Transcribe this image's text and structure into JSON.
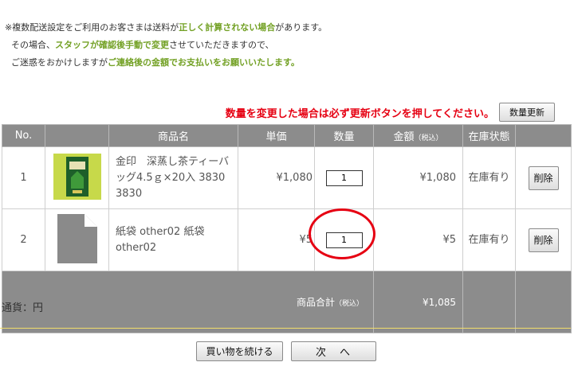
{
  "notice": {
    "line1": [
      {
        "t": "※複数配送設定をご利用のお客さまは送料が",
        "g": false
      },
      {
        "t": "正しく計算されない場合",
        "g": true
      },
      {
        "t": "があります。",
        "g": false
      }
    ],
    "line2": [
      {
        "t": "その場合、",
        "g": false
      },
      {
        "t": "スタッフが確認後手動で変更",
        "g": true
      },
      {
        "t": "させていただきますので、",
        "g": false
      }
    ],
    "line3": [
      {
        "t": "ご迷惑をおかけしますが",
        "g": false
      },
      {
        "t": "ご連絡後の金額でお支払いをお願いいたします。",
        "g": true
      }
    ]
  },
  "update": {
    "message": "数量を変更した場合は必ず更新ボタンを押してください。",
    "button": "数量更新"
  },
  "table": {
    "headers": {
      "no": "No.",
      "name": "商品名",
      "unit_price": "単価",
      "qty": "数量",
      "amount": "金額",
      "amount_tax": "（税込）",
      "stock": "在庫状態"
    },
    "rows": [
      {
        "no": "1",
        "image": "tea-package",
        "name": "金印　深蒸し茶ティーバッグ4.5ｇ×20入 3830 3830",
        "price": "¥1,080",
        "qty": "1",
        "amount": "¥1,080",
        "stock": "在庫有り",
        "delete": "削除"
      },
      {
        "no": "2",
        "image": "no-image-placeholder",
        "name": "紙袋 other02 紙袋 other02",
        "price": "¥5",
        "qty": "1",
        "amount": "¥5",
        "stock": "在庫有り",
        "delete": "削除"
      }
    ],
    "total_label": "商品合計",
    "total_tax": "（税込）",
    "total_value": "¥1,085"
  },
  "currency": "通貨：円",
  "buttons": {
    "continue": "買い物を続ける",
    "next": "次　へ"
  },
  "colors": {
    "accent_green": "#73a125",
    "alert_red": "#e60012",
    "header_gray": "#8c8c8c",
    "divider_yellow": "#f2dd6a"
  }
}
